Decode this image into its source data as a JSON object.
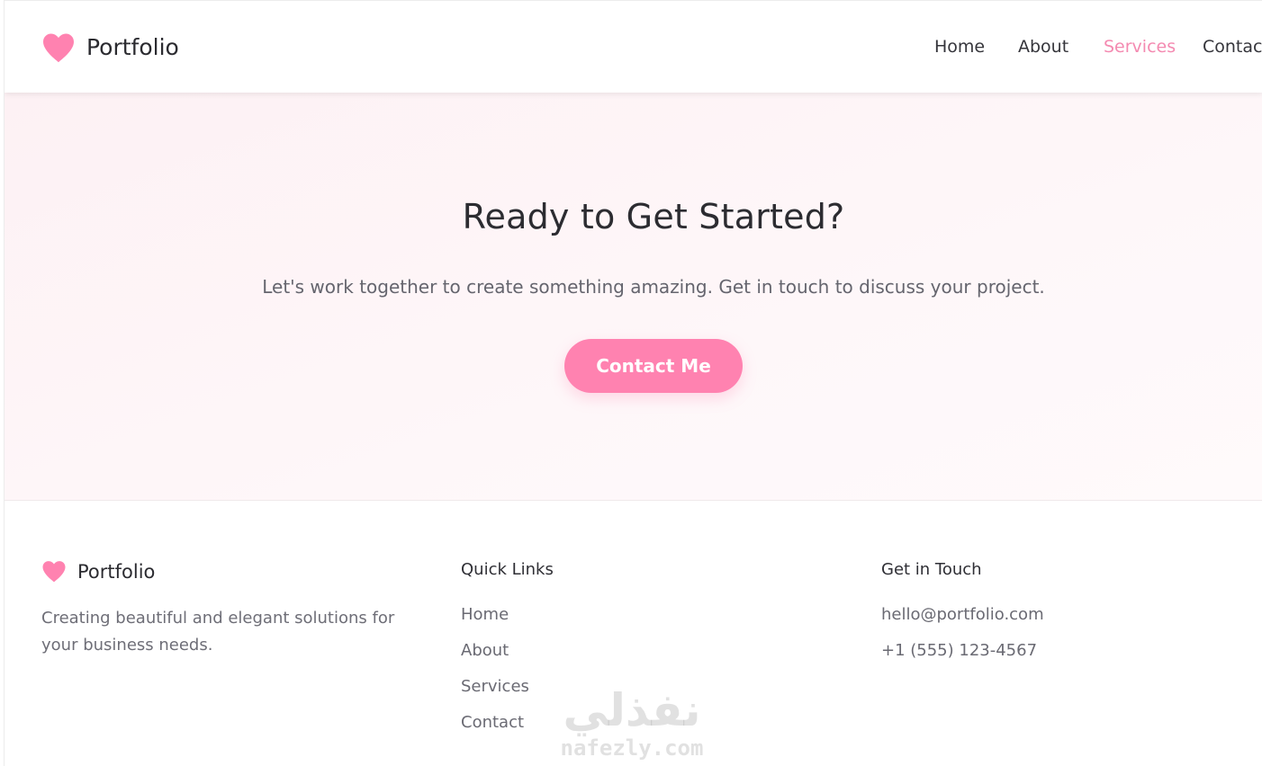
{
  "brand": {
    "name": "Portfolio",
    "icon": "heart-icon",
    "accent_color": "#ff82b0"
  },
  "nav": {
    "items": [
      {
        "label": "Home"
      },
      {
        "label": "About"
      },
      {
        "label": "Services",
        "active": true
      },
      {
        "label": "Contact"
      }
    ],
    "active_color": "#f48ab1"
  },
  "hero": {
    "title": "Ready to Get Started?",
    "subtitle": "Let's work together to create something amazing. Get in touch to discuss your project.",
    "cta_label": "Contact Me"
  },
  "footer": {
    "brand_name": "Portfolio",
    "description": "Creating beautiful and elegant solutions for your business needs.",
    "quick_links": {
      "title": "Quick Links",
      "links": [
        "Home",
        "About",
        "Services",
        "Contact"
      ]
    },
    "contact": {
      "title": "Get in Touch",
      "email": "hello@portfolio.com",
      "phone": "+1 (555) 123-4567"
    }
  },
  "watermark": {
    "arabic": "نفذلي",
    "latin": "nafezly.com"
  }
}
